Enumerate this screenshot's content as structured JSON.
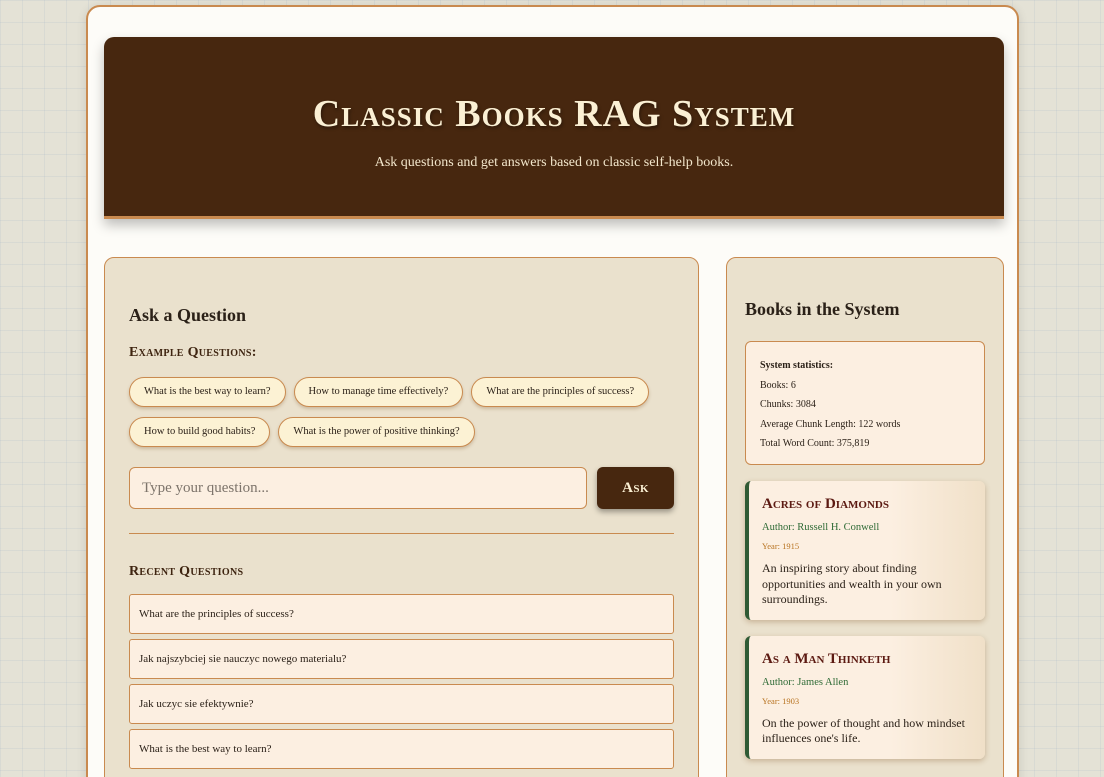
{
  "header": {
    "title": "Classic Books RAG System",
    "subtitle": "Ask questions and get answers based on classic self-help books."
  },
  "ask": {
    "heading": "Ask a Question",
    "examples_title": "Example Questions:",
    "examples": [
      "What is the best way to learn?",
      "How to manage time effectively?",
      "What are the principles of success?",
      "How to build good habits?",
      "What is the power of positive thinking?"
    ],
    "input_placeholder": "Type your question...",
    "input_value": "",
    "ask_label": "Ask"
  },
  "recent": {
    "title": "Recent Questions",
    "items": [
      "What are the principles of success?",
      "Jak najszybciej sie nauczyc nowego materialu?",
      "Jak uczyc sie efektywnie?",
      "What is the best way to learn?"
    ]
  },
  "sidebar": {
    "heading": "Books in the System",
    "stats": {
      "heading": "System statistics:",
      "books": "Books: 6",
      "chunks": "Chunks: 3084",
      "avg_chunk": "Average Chunk Length: 122 words",
      "word_count": "Total Word Count: 375,819"
    },
    "books": [
      {
        "title": "Acres of Diamonds",
        "author": "Author: Russell H. Conwell",
        "year": "Year: 1915",
        "description": "An inspiring story about finding opportunities and wealth in your own surroundings."
      },
      {
        "title": "As a Man Thinketh",
        "author": "Author: James Allen",
        "year": "Year: 1903",
        "description": "On the power of thought and how mindset influences one's life."
      }
    ]
  },
  "colors": {
    "header_bg": "#47270f",
    "accent_border": "#c98a4f",
    "panel_bg": "#eae1cd",
    "book_title": "#5c1a12",
    "author": "#2f6b36",
    "year": "#b87320"
  }
}
